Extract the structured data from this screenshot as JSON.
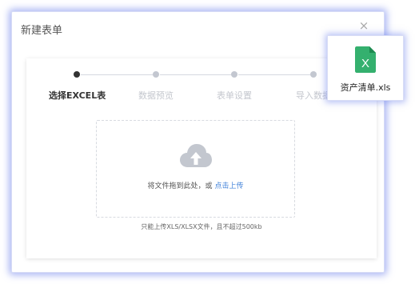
{
  "dialog": {
    "title": "新建表单",
    "close_glyph": "×"
  },
  "steps": [
    {
      "label": "选择EXCEL表",
      "active": true
    },
    {
      "label": "数据预览",
      "active": false
    },
    {
      "label": "表单设置",
      "active": false
    },
    {
      "label": "导入数据",
      "active": false
    }
  ],
  "upload": {
    "drop_text": "将文件拖到此处，或",
    "link_text": "点击上传",
    "hint": "只能上传XLS/XLSX文件，且不超过500kb",
    "icon": "cloud-upload-icon"
  },
  "dragged_file": {
    "name": "资产清单.xls",
    "icon": "excel-file-icon",
    "icon_letter": "X"
  },
  "colors": {
    "accent": "#3d7fd8",
    "excel_green": "#21a366",
    "highlight": "#6a7deb"
  }
}
